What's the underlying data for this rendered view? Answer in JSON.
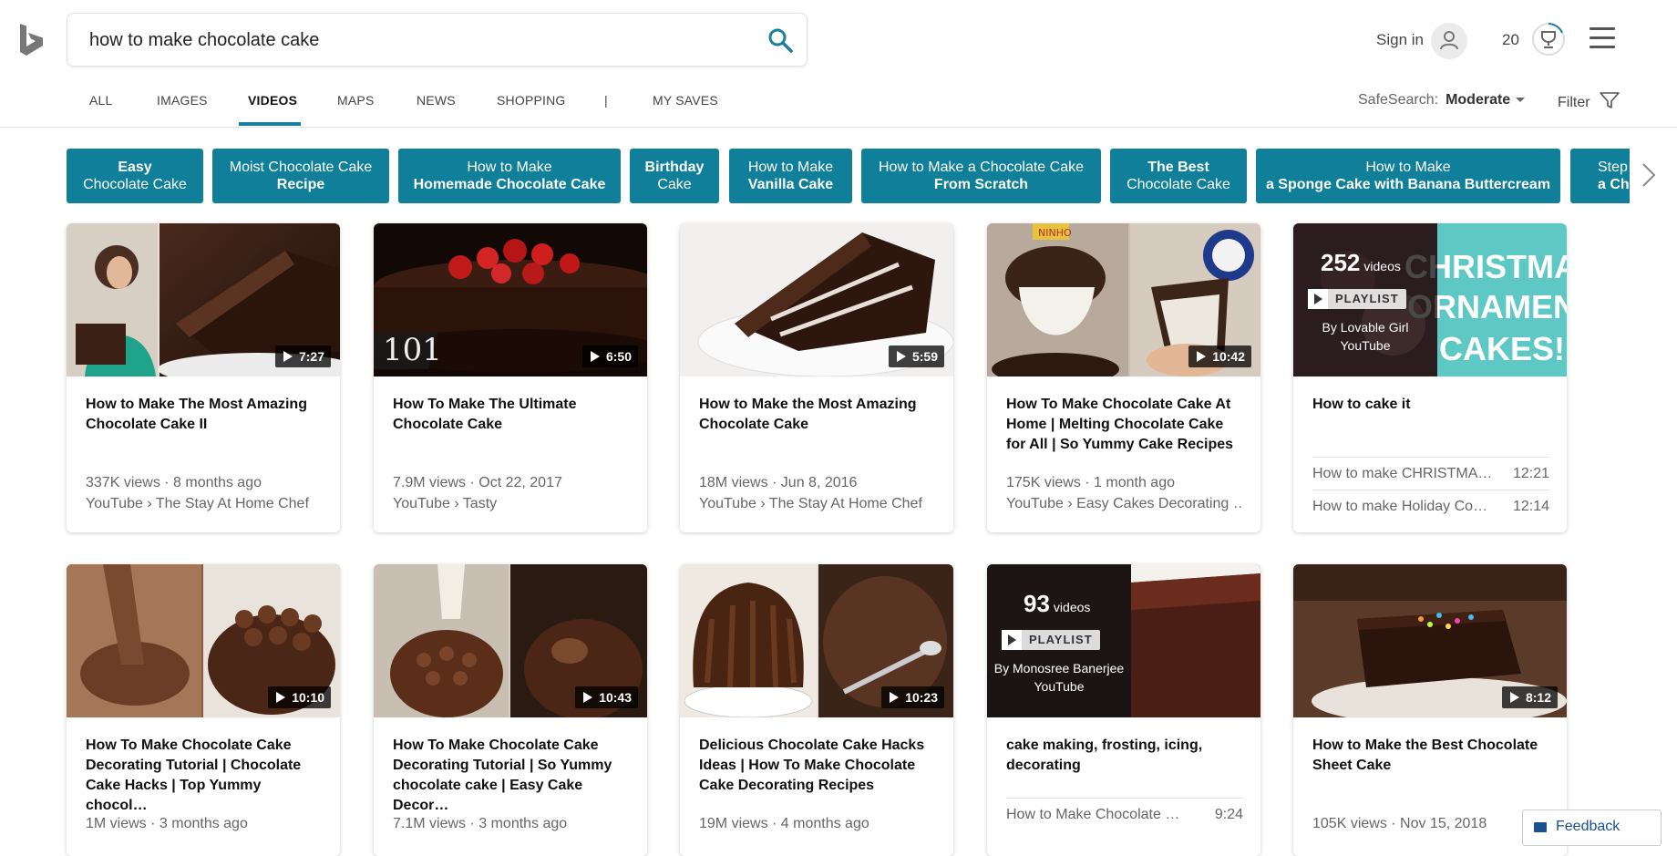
{
  "search": {
    "query": "how to make chocolate cake"
  },
  "header": {
    "sign_in": "Sign in",
    "points": "20"
  },
  "nav": {
    "items": [
      "ALL",
      "IMAGES",
      "VIDEOS",
      "MAPS",
      "NEWS",
      "SHOPPING",
      "|",
      "MY SAVES"
    ],
    "active": "VIDEOS"
  },
  "safesearch": {
    "label": "SafeSearch:",
    "value": "Moderate"
  },
  "filter": {
    "label": "Filter"
  },
  "chips": [
    {
      "line1": "Easy",
      "line2": "Chocolate Cake"
    },
    {
      "line1": "Moist Chocolate Cake",
      "line2": "Recipe"
    },
    {
      "line1": "How to Make",
      "line2": "Homemade Chocolate Cake"
    },
    {
      "line1": "Birthday",
      "line2": "Cake"
    },
    {
      "line1": "How to Make",
      "line2": "Vanilla Cake"
    },
    {
      "line1": "How to Make a Chocolate Cake",
      "line2": "From Scratch"
    },
    {
      "line1": "The Best",
      "line2": "Chocolate Cake"
    },
    {
      "line1": "How to Make",
      "line2": "a Sponge Cake with Banana Buttercream"
    },
    {
      "line1": "Step",
      "line2": "a Cho"
    }
  ],
  "videos": [
    {
      "title": "How to Make The Most Amazing Chocolate Cake II",
      "duration": "7:27",
      "views": "337K views · 8 months ago",
      "source": "YouTube › The Stay At Home Chef"
    },
    {
      "title": "How To Make The Ultimate Chocolate Cake",
      "duration": "6:50",
      "views": "7.9M views · Oct 22, 2017",
      "source": "YouTube › Tasty",
      "thumb_text": "101"
    },
    {
      "title": "How to Make the Most Amazing Chocolate Cake",
      "duration": "5:59",
      "views": "18M views · Jun 8, 2016",
      "source": "YouTube › The Stay At Home Chef"
    },
    {
      "title": "How To Make Chocolate Cake At Home | Melting Chocolate Cake for All | So Yummy Cake Recipes",
      "duration": "10:42",
      "views": "175K views · 1 month ago",
      "source": "YouTube › Easy Cakes Decorating …",
      "thumb_text": "NINHO"
    },
    {
      "title": "How to cake it",
      "playlist": {
        "count": "252",
        "count_label": "videos",
        "badge": "PLAYLIST",
        "by": "By Lovable Girl",
        "site": "YouTube",
        "thumb_text": "CHRISTMAS ORNAMENT CAKES!"
      },
      "items": [
        {
          "title": "How to make CHRISTMA…",
          "duration": "12:21"
        },
        {
          "title": "How to make Holiday Coo…",
          "duration": "12:14"
        }
      ]
    },
    {
      "title": "How To Make Chocolate Cake Decorating Tutorial | Chocolate Cake Hacks | Top Yummy chocol…",
      "duration": "10:10",
      "views": "1M views · 3 months ago"
    },
    {
      "title": "How To Make Chocolate Cake Decorating Tutorial | So Yummy chocolate cake | Easy Cake Decor…",
      "duration": "10:43",
      "views": "7.1M views · 3 months ago"
    },
    {
      "title": "Delicious Chocolate Cake Hacks Ideas | How To Make Chocolate Cake Decorating Recipes",
      "duration": "10:23",
      "views": "19M views · 4 months ago"
    },
    {
      "title": "cake making, frosting, icing, decorating",
      "playlist": {
        "count": "93",
        "count_label": "videos",
        "badge": "PLAYLIST",
        "by": "By Monosree Banerjee",
        "site": "YouTube"
      },
      "items": [
        {
          "title": "How to Make Chocolate C…",
          "duration": "9:24"
        }
      ]
    },
    {
      "title": "How to Make the Best Chocolate Sheet Cake",
      "duration": "8:12",
      "views": "105K views · Nov 15, 2018"
    }
  ],
  "feedback": {
    "label": "Feedback"
  },
  "colors": {
    "accent": "#0f7f9a",
    "nav_underline": "#1a7fa0",
    "search_icon": "#1a7fa0"
  }
}
